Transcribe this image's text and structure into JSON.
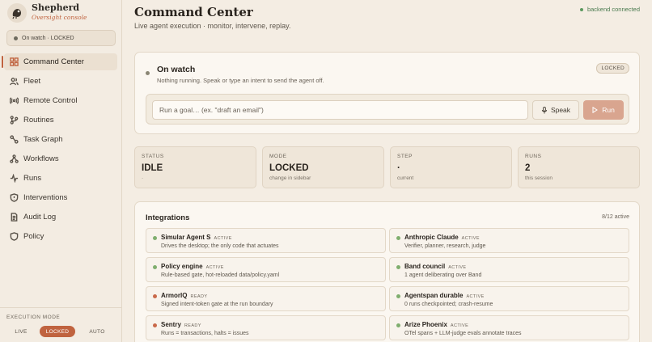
{
  "brand": {
    "name": "Shepherd",
    "subtitle": "Oversight console"
  },
  "sidebar": {
    "watch_status": "On watch · LOCKED",
    "items": [
      {
        "label": "Command Center",
        "icon": "grid-icon",
        "active": true
      },
      {
        "label": "Fleet",
        "icon": "users-icon"
      },
      {
        "label": "Remote Control",
        "icon": "signal-icon"
      },
      {
        "label": "Routines",
        "icon": "branch-icon"
      },
      {
        "label": "Task Graph",
        "icon": "graph-icon"
      },
      {
        "label": "Workflows",
        "icon": "workflow-icon"
      },
      {
        "label": "Runs",
        "icon": "activity-icon"
      },
      {
        "label": "Interventions",
        "icon": "shield-alert-icon"
      },
      {
        "label": "Audit Log",
        "icon": "document-icon"
      },
      {
        "label": "Policy",
        "icon": "shield-icon"
      }
    ],
    "execution_mode": {
      "label": "EXECUTION MODE",
      "options": [
        "LIVE",
        "LOCKED",
        "AUTO"
      ],
      "selected": "LOCKED"
    }
  },
  "header": {
    "title": "Command Center",
    "subtitle": "Live agent execution · monitor, intervene, replay.",
    "backend_status": "backend connected"
  },
  "watch": {
    "title": "On watch",
    "description": "Nothing running. Speak or type an intent to send the agent off.",
    "badge": "LOCKED",
    "goal_placeholder": "Run a goal… (ex. \"draft an email\")",
    "speak_label": "Speak",
    "run_label": "Run"
  },
  "stats": [
    {
      "label": "STATUS",
      "value": "IDLE",
      "sub": "·"
    },
    {
      "label": "MODE",
      "value": "LOCKED",
      "sub": "change in sidebar"
    },
    {
      "label": "STEP",
      "value": "·",
      "sub": "current"
    },
    {
      "label": "RUNS",
      "value": "2",
      "sub": "this session"
    }
  ],
  "integrations": {
    "title": "Integrations",
    "count": "8/12 active",
    "items": [
      {
        "name": "Simular Agent S",
        "status": "ACTIVE",
        "desc": "Drives the desktop; the only code that actuates",
        "color": "#7fae6e"
      },
      {
        "name": "Anthropic Claude",
        "status": "ACTIVE",
        "desc": "Verifier, planner, research, judge",
        "color": "#7fae6e"
      },
      {
        "name": "Policy engine",
        "status": "ACTIVE",
        "desc": "Rule-based gate, hot-reloaded data/policy.yaml",
        "color": "#7fae6e"
      },
      {
        "name": "Band council",
        "status": "ACTIVE",
        "desc": "1 agent deliberating over Band",
        "color": "#7fae6e"
      },
      {
        "name": "ArmorIQ",
        "status": "READY",
        "desc": "Signed intent-token gate at the run boundary",
        "color": "#c9694a"
      },
      {
        "name": "Agentspan durable",
        "status": "ACTIVE",
        "desc": "0 runs checkpointed; crash-resume",
        "color": "#7fae6e"
      },
      {
        "name": "Sentry",
        "status": "READY",
        "desc": "Runs = transactions, halts = issues",
        "color": "#c9694a"
      },
      {
        "name": "Arize Phoenix",
        "status": "ACTIVE",
        "desc": "OTel spans + LLM-judge evals annotate traces",
        "color": "#7fae6e"
      }
    ]
  }
}
